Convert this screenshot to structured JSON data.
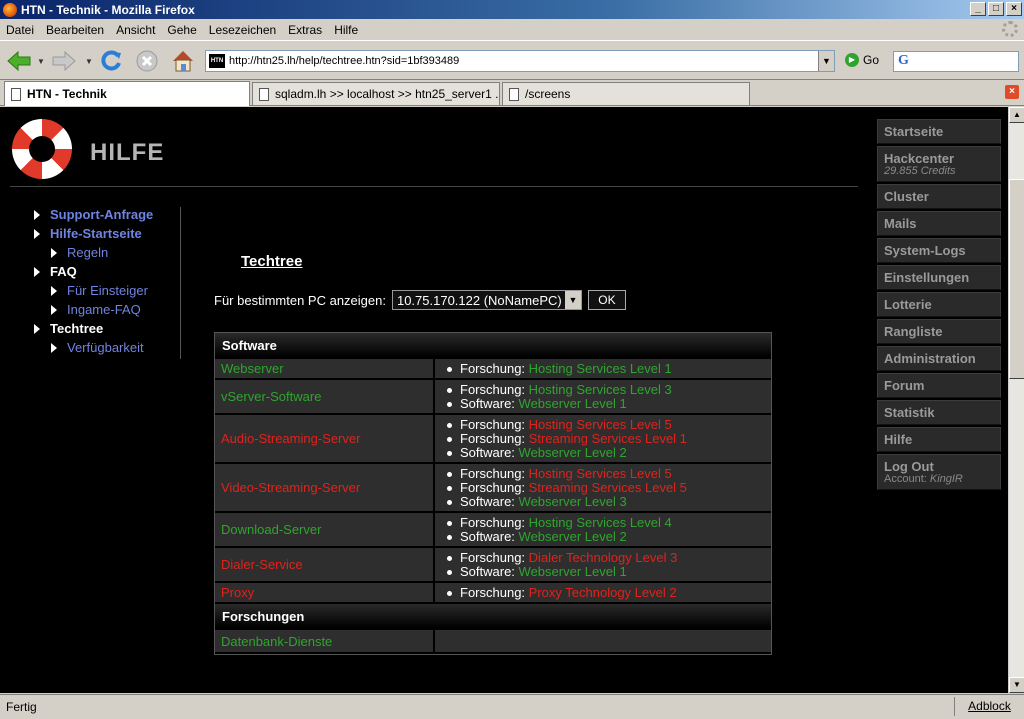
{
  "window": {
    "title": "HTN - Technik - Mozilla Firefox"
  },
  "menubar": [
    "Datei",
    "Bearbeiten",
    "Ansicht",
    "Gehe",
    "Lesezeichen",
    "Extras",
    "Hilfe"
  ],
  "navbar": {
    "url": "http://htn25.lh/help/techtree.htn?sid=1bf393489",
    "go_label": "Go",
    "favicon_text": "HTN"
  },
  "tabs": [
    {
      "label": "HTN - Technik",
      "active": true
    },
    {
      "label": "sqladm.lh >> localhost >> htn25_server1 ...",
      "active": false
    },
    {
      "label": "/screens",
      "active": false
    }
  ],
  "page": {
    "header_title": "HILFE",
    "left_nav": [
      {
        "label": "Support-Anfrage",
        "level": 0,
        "style": "bold-blue"
      },
      {
        "label": "Hilfe-Startseite",
        "level": 0,
        "style": "bold-blue"
      },
      {
        "label": "Regeln",
        "level": 1,
        "style": "blue"
      },
      {
        "label": "FAQ",
        "level": 0,
        "style": "bold-white"
      },
      {
        "label": "Für Einsteiger",
        "level": 1,
        "style": "blue"
      },
      {
        "label": "Ingame-FAQ",
        "level": 1,
        "style": "blue"
      },
      {
        "label": "Techtree",
        "level": 0,
        "style": "bold-white"
      },
      {
        "label": "Verfügbarkeit",
        "level": 1,
        "style": "blue"
      }
    ],
    "techtree_title": "Techtree",
    "pc_filter": {
      "label": "Für bestimmten PC anzeigen:",
      "selected": "10.75.170.122 (NoNamePC)",
      "ok_label": "OK"
    },
    "sections": [
      {
        "title": "Software",
        "rows": [
          {
            "name": "Webserver",
            "status": "ok",
            "reqs": [
              {
                "kind": "Forschung:",
                "value": "Hosting Services Level 1",
                "status": "ok"
              }
            ]
          },
          {
            "name": "vServer-Software",
            "status": "ok",
            "reqs": [
              {
                "kind": "Forschung:",
                "value": "Hosting Services Level 3",
                "status": "ok"
              },
              {
                "kind": "Software:",
                "value": "Webserver Level 1",
                "status": "ok"
              }
            ]
          },
          {
            "name": "Audio-Streaming-Server",
            "status": "bad",
            "reqs": [
              {
                "kind": "Forschung:",
                "value": "Hosting Services Level 5",
                "status": "bad"
              },
              {
                "kind": "Forschung:",
                "value": "Streaming Services Level 1",
                "status": "bad"
              },
              {
                "kind": "Software:",
                "value": "Webserver Level 2",
                "status": "ok"
              }
            ]
          },
          {
            "name": "Video-Streaming-Server",
            "status": "bad",
            "reqs": [
              {
                "kind": "Forschung:",
                "value": "Hosting Services Level 5",
                "status": "bad"
              },
              {
                "kind": "Forschung:",
                "value": "Streaming Services Level 5",
                "status": "bad"
              },
              {
                "kind": "Software:",
                "value": "Webserver Level 3",
                "status": "ok"
              }
            ]
          },
          {
            "name": "Download-Server",
            "status": "ok",
            "reqs": [
              {
                "kind": "Forschung:",
                "value": "Hosting Services Level 4",
                "status": "ok"
              },
              {
                "kind": "Software:",
                "value": "Webserver Level 2",
                "status": "ok"
              }
            ]
          },
          {
            "name": "Dialer-Service",
            "status": "bad",
            "reqs": [
              {
                "kind": "Forschung:",
                "value": "Dialer Technology Level 3",
                "status": "bad"
              },
              {
                "kind": "Software:",
                "value": "Webserver Level 1",
                "status": "ok"
              }
            ]
          },
          {
            "name": "Proxy",
            "status": "bad",
            "reqs": [
              {
                "kind": "Forschung:",
                "value": "Proxy Technology Level 2",
                "status": "bad"
              }
            ]
          }
        ]
      },
      {
        "title": "Forschungen",
        "rows": [
          {
            "name": "Datenbank-Dienste",
            "status": "ok",
            "reqs": []
          }
        ]
      }
    ],
    "right_nav": [
      {
        "label": "Startseite"
      },
      {
        "label": "Hackcenter",
        "sub": "29.855 Credits"
      },
      {
        "label": "Cluster"
      },
      {
        "label": "Mails"
      },
      {
        "label": "System-Logs"
      },
      {
        "label": "Einstellungen"
      },
      {
        "label": "Lotterie"
      },
      {
        "label": "Rangliste"
      },
      {
        "label": "Administration"
      },
      {
        "label": "Forum"
      },
      {
        "label": "Statistik"
      },
      {
        "label": "Hilfe"
      },
      {
        "label": "Log Out",
        "sub_prefix": "Account: ",
        "sub_name": "KingIR"
      }
    ]
  },
  "statusbar": {
    "text": "Fertig",
    "adblock": "Adblock"
  },
  "colors": {
    "ok": "#2fa52f",
    "bad": "#e0231b",
    "nav_blue": "#6f83e0"
  },
  "icons": [
    "firefox-icon",
    "back-icon",
    "forward-icon",
    "reload-icon",
    "stop-icon",
    "home-icon",
    "go-icon",
    "google-icon",
    "close-tab-icon"
  ]
}
